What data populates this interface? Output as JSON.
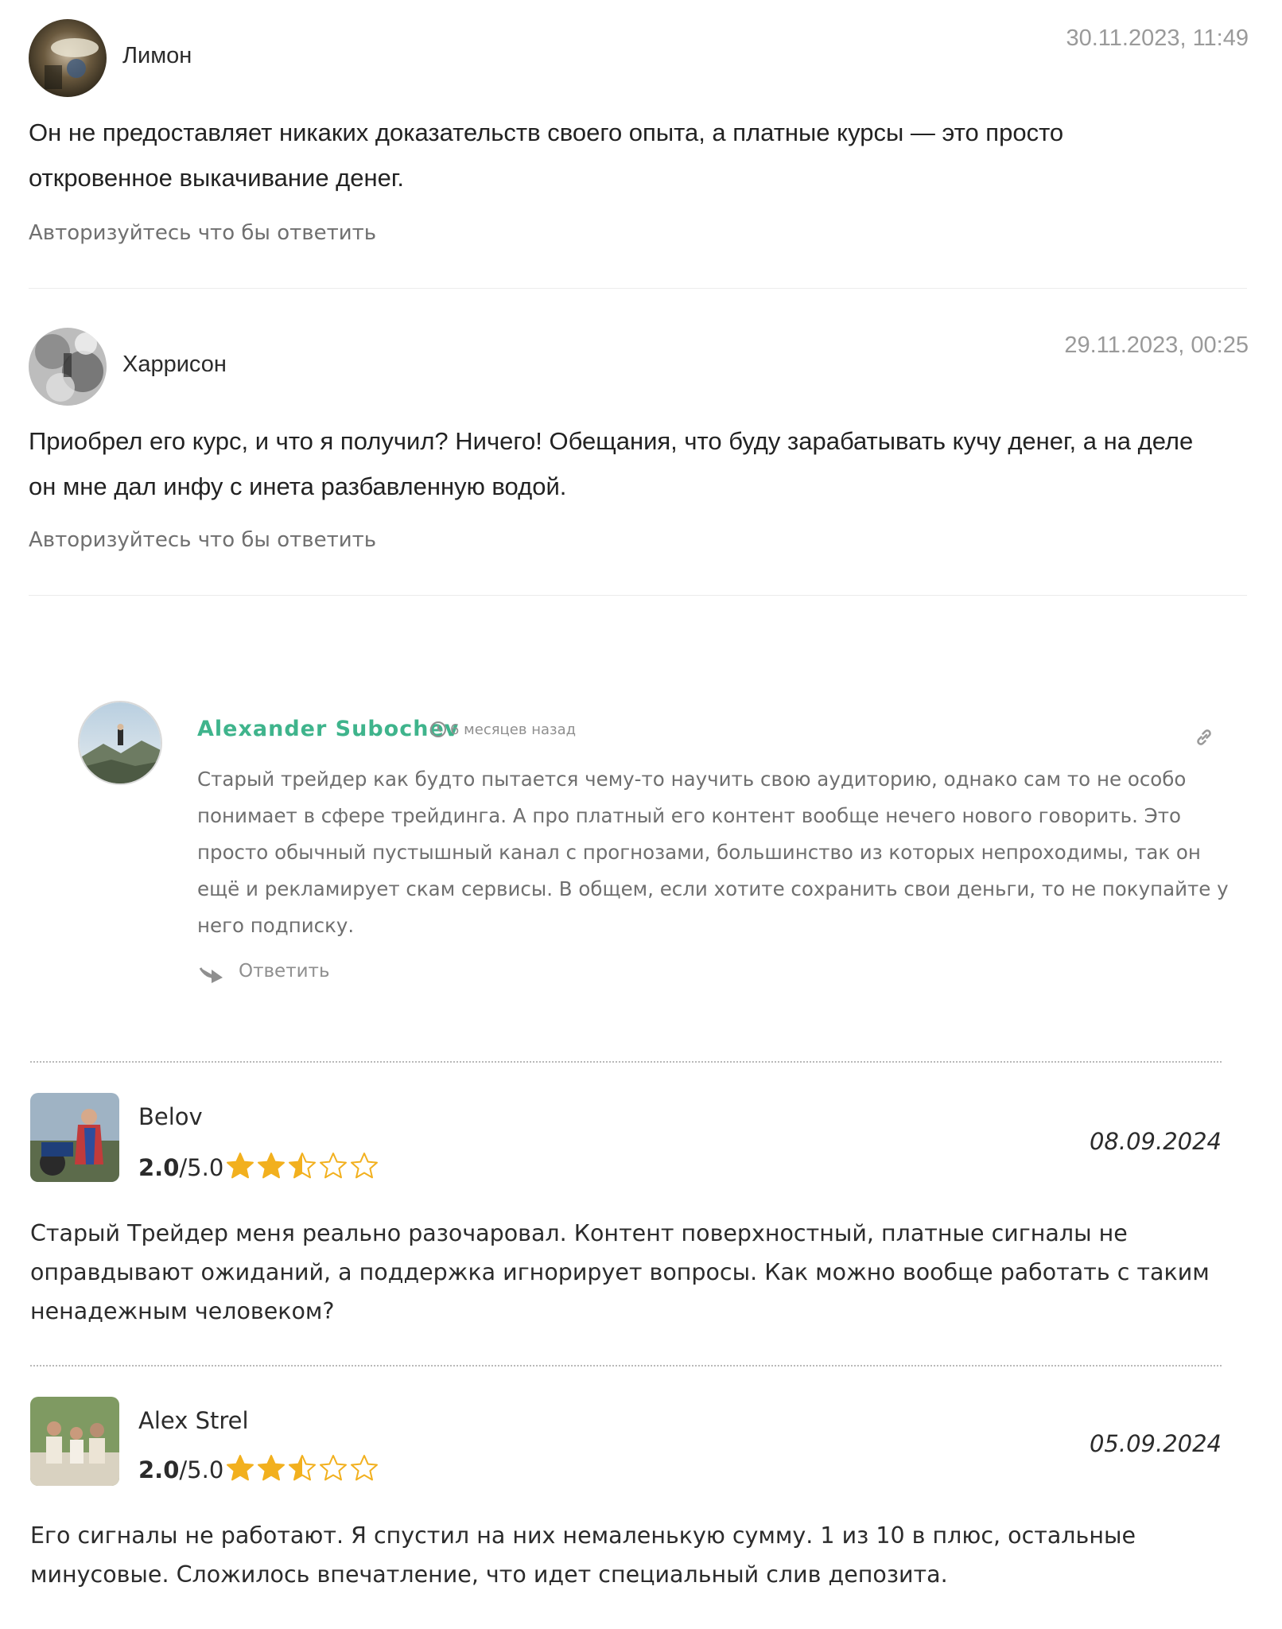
{
  "comments": [
    {
      "name": "Лимон",
      "date": "30.11.2023, 11:49",
      "text": "Он не предоставляет никаких доказательств своего опыта, а платные курсы — это просто откровенное выкачивание денег.",
      "reply": "Авторизуйтесь что бы ответить"
    },
    {
      "name": "Харрисон",
      "date": "29.11.2023, 00:25",
      "text": "Приобрел его курс, и что я получил? Ничего! Обещания, что буду зарабатывать кучу денег, а на деле он мне дал инфу с инета разбавленную водой.",
      "reply": "Авторизуйтесь что бы ответить"
    }
  ],
  "thread": {
    "name": "Alexander Subochev",
    "time": "6 месяцев назад",
    "text": "Старый трейдер как будто пытается чему-то научить свою аудиторию, однако сам то не особо понимает в сфере трейдинга. А про платный его контент вообще нечего нового говорить. Это просто обычный пустышный канал с прогнозами, большинство из которых непроходимы, так он ещё и рекламирует скам сервисы. В общем, если хотите сохранить свои деньги, то не покупайте у него подписку.",
    "reply": "Ответить",
    "icons": [
      "clock-icon",
      "link-icon",
      "reply-arrow-icon"
    ],
    "accent_color": "#3fb48c"
  },
  "reviews": [
    {
      "name": "Belov",
      "rating": "2.0",
      "rating_max": "/5.0",
      "stars": 2.5,
      "date": "08.09.2024",
      "text": "Старый Трейдер меня реально разочаровал. Контент поверхностный, платные сигналы не оправдывают ожиданий, а поддержка игнорирует вопросы. Как можно вообще работать с таким ненадежным человеком?"
    },
    {
      "name": "Alex Strel",
      "rating": "2.0",
      "rating_max": "/5.0",
      "stars": 2.5,
      "date": "05.09.2024",
      "text": "Его сигналы не работают. Я спустил на них немаленькую сумму. 1 из 10 в плюс, остальные минусовые. Сложилось впечатление, что идет специальный слив депозита."
    }
  ],
  "star_color": "#f2b01e"
}
